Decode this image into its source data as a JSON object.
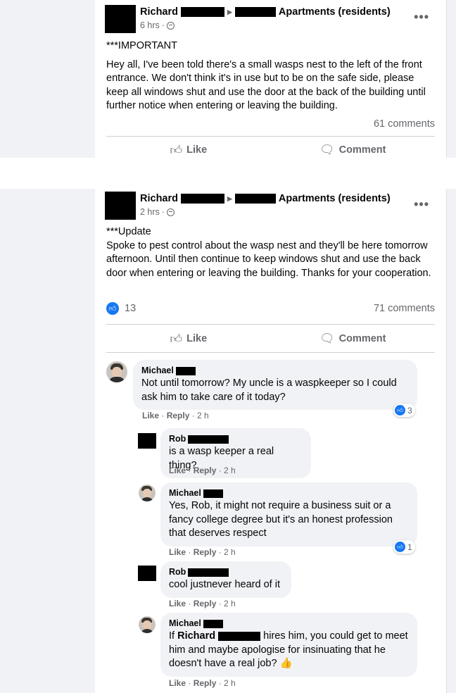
{
  "post1": {
    "author": "Richard",
    "group": "Apartments (residents)",
    "time": "6 hrs",
    "more_icon": "•••",
    "body": [
      "***IMPORTANT",
      "Hey all, I've been told there's a small wasps nest to the left of the front entrance. We don't think it's in use but to be on the safe side, please keep all windows shut and use the door at the back of the building until further notice when entering or leaving the building."
    ],
    "comments_count": "61 comments",
    "like_label": "Like",
    "comment_label": "Comment"
  },
  "post2": {
    "author": "Richard",
    "group": "Apartments (residents)",
    "time": "2 hrs",
    "more_icon": "•••",
    "body": [
      "***Update",
      "Spoke to pest control about the wasp nest and they'll be here tomorrow afternoon. Until then continue to keep windows shut and use the back door when entering or leaving the building. Thanks for your cooperation."
    ],
    "reactions": "13",
    "comments_count": "71 comments",
    "like_label": "Like",
    "comment_label": "Comment"
  },
  "comments": [
    {
      "author": "Michael",
      "text": "Not until tomorrow? My uncle is a waspkeeper so I could ask him to take care of it today?",
      "like": "Like",
      "reply": "Reply",
      "time": "2 h",
      "reactions": "3"
    },
    {
      "author": "Rob",
      "text": "is a wasp keeper a real thing?",
      "like": "Like",
      "reply": "Reply",
      "time": "2 h"
    },
    {
      "author": "Michael",
      "text": "Yes, Rob, it might not require a business suit or a fancy college degree but it's an honest profession that deserves respect",
      "like": "Like",
      "reply": "Reply",
      "time": "2 h",
      "reactions": "1"
    },
    {
      "author": "Rob",
      "text": "cool justnever heard of it",
      "like": "Like",
      "reply": "Reply",
      "time": "2 h"
    },
    {
      "author": "Michael",
      "text_pre": "If",
      "mention": "Richard",
      "text_post": "hires him, you could get to meet him and maybe apologise for insinuating that he doesn't have a real job?",
      "emoji": "👍",
      "like": "Like",
      "reply": "Reply",
      "time": "2 h"
    }
  ],
  "icons": {
    "like": "thumbs-up-icon",
    "comment": "speech-bubble-icon",
    "privacy": "globe-icon",
    "more": "more-dots-icon"
  },
  "colors": {
    "like_blue": "#1877f2",
    "meta_gray": "#65676b",
    "bubble_gray": "#f0f2f5"
  }
}
